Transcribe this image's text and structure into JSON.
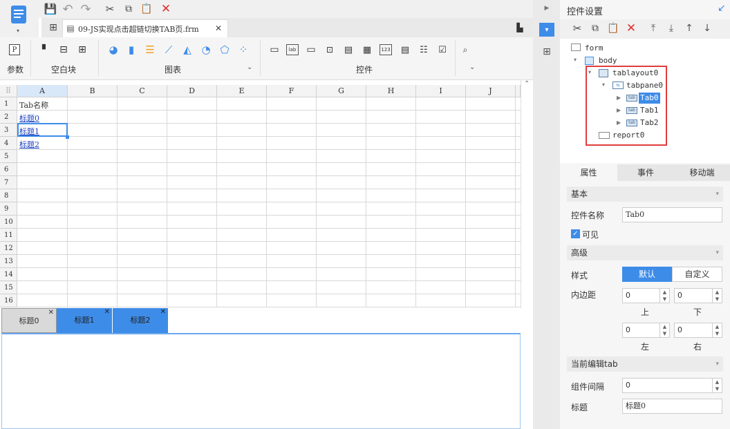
{
  "file_tab": {
    "title": "09-JS实现点击超链切换TAB页.frm"
  },
  "ribbon": {
    "groups": [
      "参数",
      "空白块",
      "图表",
      "控件"
    ],
    "param_icon_label": "P"
  },
  "grid": {
    "col_headers": [
      "A",
      "B",
      "C",
      "D",
      "E",
      "F",
      "G",
      "H",
      "I",
      "J"
    ],
    "row_headers": [
      "1",
      "2",
      "3",
      "4",
      "5",
      "6",
      "7",
      "8",
      "9",
      "10",
      "11",
      "12",
      "13",
      "14",
      "15",
      "16"
    ],
    "cells": {
      "a1": "Tab名称",
      "a2": "标题0",
      "a3": "标题1",
      "a4": "标题2"
    },
    "corner": "⠿"
  },
  "bottom_tabs": [
    "标题0",
    "标题1",
    "标题2"
  ],
  "right_panel": {
    "title": "控件设置",
    "tree": {
      "form": "form",
      "body": "body",
      "tablayout": "tablayout0",
      "tabpane": "tabpane0",
      "tab0": "Tab0",
      "tab1": "Tab1",
      "tab2": "Tab2",
      "report": "report0",
      "tab_badge": "tab"
    },
    "tabs": [
      "属性",
      "事件",
      "移动端"
    ],
    "basic": {
      "header": "基本",
      "name_label": "控件名称",
      "name_value": "Tab0",
      "visible_label": "可见"
    },
    "advanced": {
      "header": "高级",
      "style_label": "样式",
      "style_default": "默认",
      "style_custom": "自定义",
      "padding_label": "内边距",
      "top_value": "0",
      "top_label": "上",
      "bottom_value": "0",
      "bottom_label": "下",
      "left_value": "0",
      "left_label": "左",
      "right_value": "0",
      "right_label": "右"
    },
    "current_tab": {
      "header": "当前编辑tab",
      "gap_label": "组件间隔",
      "gap_value": "0",
      "title_label": "标题",
      "title_value": "标题0"
    }
  },
  "colors": {
    "accent": "#3d8ce8",
    "selected_tab": "#3d8ce8",
    "highlight_box": "#e03c3c",
    "delete_red": "#e03030"
  }
}
